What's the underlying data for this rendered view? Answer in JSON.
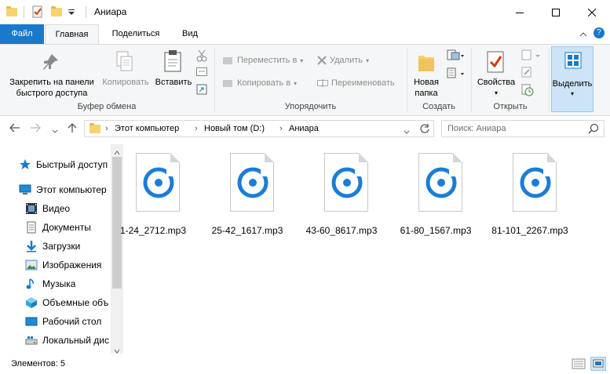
{
  "window": {
    "title": "Аниара"
  },
  "tabs": [
    "Файл",
    "Главная",
    "Поделиться",
    "Вид"
  ],
  "ribbon": {
    "clipboard": {
      "pin_label_line1": "Закрепить на панели",
      "pin_label_line2": "быстрого доступа",
      "copy": "Копировать",
      "paste": "Вставить",
      "group": "Буфер обмена"
    },
    "organize": {
      "move_to": "Переместить в",
      "copy_to": "Копировать в",
      "delete": "Удалить",
      "rename": "Переименовать",
      "group": "Упорядочить"
    },
    "create": {
      "new_folder_line1": "Новая",
      "new_folder_line2": "папка",
      "group": "Создать"
    },
    "open": {
      "properties": "Свойства",
      "group": "Открыть"
    },
    "select": {
      "label": "Выделить"
    }
  },
  "address": {
    "crumbs": [
      "Этот компьютер",
      "Новый том (D:)",
      "Аниара"
    ],
    "search_placeholder": "Поиск: Аниара"
  },
  "nav": {
    "items": [
      {
        "label": "Быстрый доступ",
        "icon": "star-icon"
      },
      {
        "label": "Этот компьютер",
        "icon": "computer-icon"
      },
      {
        "label": "Видео",
        "icon": "video-icon"
      },
      {
        "label": "Документы",
        "icon": "documents-icon"
      },
      {
        "label": "Загрузки",
        "icon": "downloads-icon"
      },
      {
        "label": "Изображения",
        "icon": "pictures-icon"
      },
      {
        "label": "Музыка",
        "icon": "music-icon"
      },
      {
        "label": "Объемные объ",
        "icon": "3d-objects-icon"
      },
      {
        "label": "Рабочий стол",
        "icon": "desktop-icon"
      },
      {
        "label": "Локальный дис",
        "icon": "local-disk-icon"
      }
    ]
  },
  "files": [
    {
      "name": "1-24_2712.mp3"
    },
    {
      "name": "25-42_1617.mp3"
    },
    {
      "name": "43-60_8617.mp3"
    },
    {
      "name": "61-80_1567.mp3"
    },
    {
      "name": "81-101_2267.mp3"
    }
  ],
  "status": {
    "count": "Элементов: 5"
  },
  "colors": {
    "accent": "#1979ca",
    "audio_icon": "#1a7dd7",
    "folder": "#f6d46b"
  }
}
